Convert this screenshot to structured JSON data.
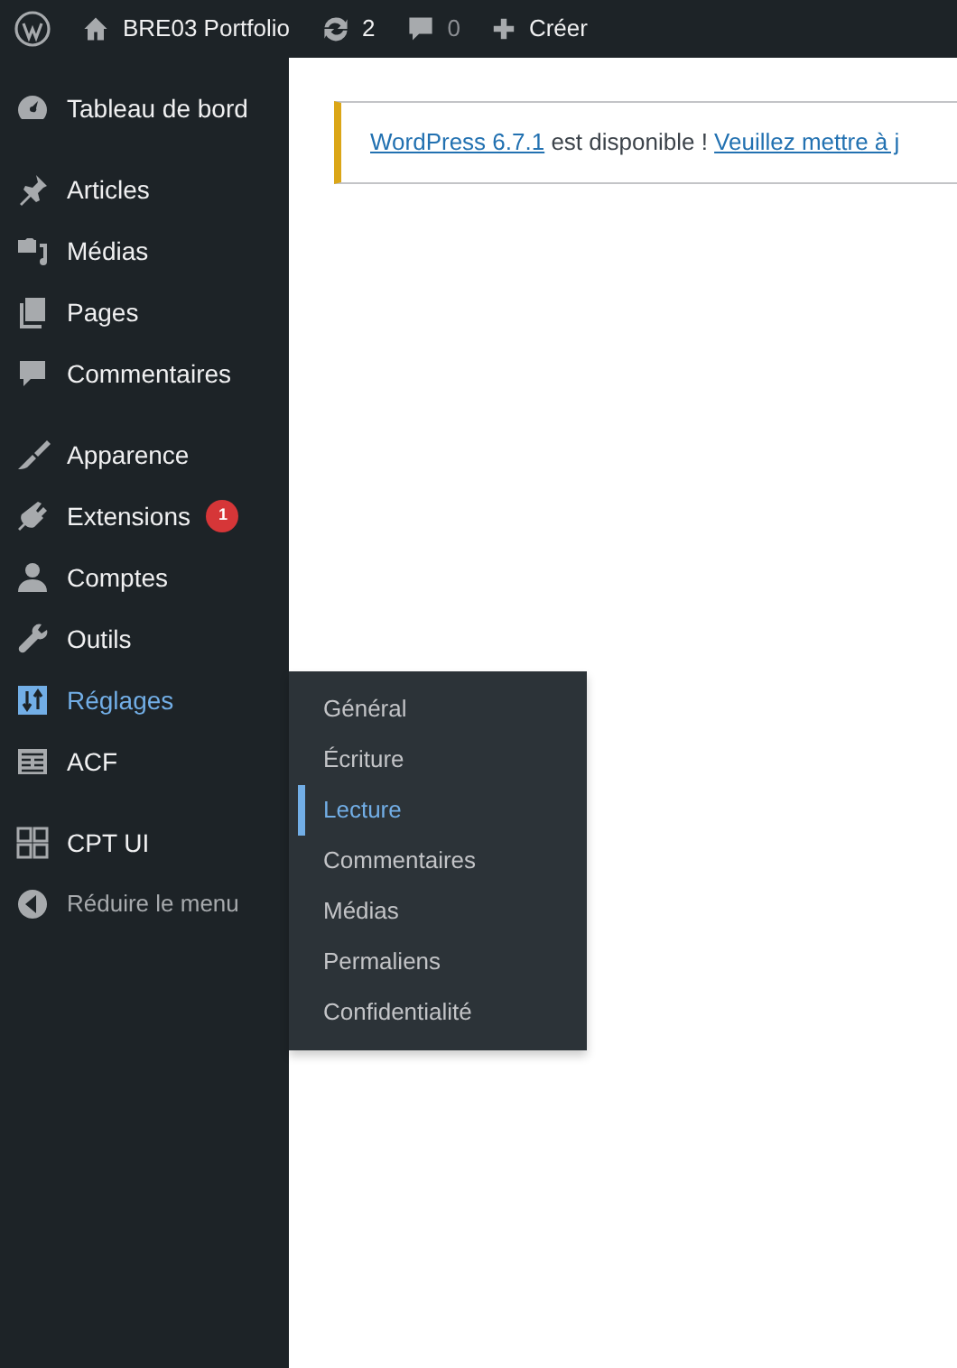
{
  "admin_bar": {
    "site_name": "BRE03 Portfolio",
    "updates_count": "2",
    "comments_count": "0",
    "new_label": "Créer"
  },
  "sidebar": {
    "groups": [
      [
        {
          "label": "Tableau de bord",
          "selected": false
        }
      ],
      [
        {
          "label": "Articles",
          "selected": false
        },
        {
          "label": "Médias",
          "selected": false
        },
        {
          "label": "Pages",
          "selected": false
        },
        {
          "label": "Commentaires",
          "selected": false
        }
      ],
      [
        {
          "label": "Apparence",
          "selected": false
        },
        {
          "label": "Extensions",
          "selected": false,
          "badge": "1"
        },
        {
          "label": "Comptes",
          "selected": false
        },
        {
          "label": "Outils",
          "selected": false
        },
        {
          "label": "Réglages",
          "selected": true
        },
        {
          "label": "ACF",
          "selected": false
        }
      ],
      [
        {
          "label": "CPT UI",
          "selected": false
        },
        {
          "label": "Réduire le menu",
          "selected": false,
          "kind": "collapse"
        }
      ]
    ]
  },
  "submenu": {
    "items": [
      {
        "label": "Général",
        "selected": false
      },
      {
        "label": "Écriture",
        "selected": false
      },
      {
        "label": "Lecture",
        "selected": true
      },
      {
        "label": "Commentaires",
        "selected": false
      },
      {
        "label": "Médias",
        "selected": false
      },
      {
        "label": "Permaliens",
        "selected": false
      },
      {
        "label": "Confidentialité",
        "selected": false
      }
    ]
  },
  "notice": {
    "version_link": "WordPress 6.7.1",
    "text": "est disponible !",
    "update_link": "Veuillez mettre à j"
  }
}
